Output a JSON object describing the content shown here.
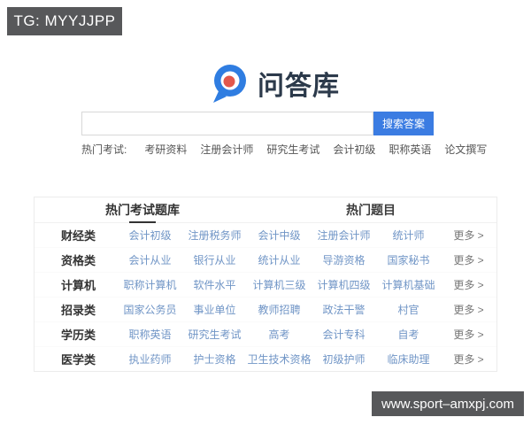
{
  "badges": {
    "top_left": "TG: MYYJJPP",
    "bottom_right": "www.sport–amxpj.com"
  },
  "logo": {
    "text": "问答库"
  },
  "search": {
    "value": "",
    "placeholder": "",
    "button_label": "搜索答案"
  },
  "hot_exams": {
    "label": "热门考试:",
    "links": [
      "考研资料",
      "注册会计师",
      "研究生考试",
      "会计初级",
      "职称英语",
      "论文撰写"
    ]
  },
  "board": {
    "tabs": [
      {
        "label": "热门考试题库",
        "active": true
      },
      {
        "label": "热门题目",
        "active": false
      }
    ],
    "more_label": "更多 >",
    "rows": [
      {
        "category": "财经类",
        "links": [
          "会计初级",
          "注册税务师",
          "会计中级",
          "注册会计师",
          "统计师"
        ]
      },
      {
        "category": "资格类",
        "links": [
          "会计从业",
          "银行从业",
          "统计从业",
          "导游资格",
          "国家秘书"
        ]
      },
      {
        "category": "计算机",
        "links": [
          "职称计算机",
          "软件水平",
          "计算机三级",
          "计算机四级",
          "计算机基础"
        ]
      },
      {
        "category": "招录类",
        "links": [
          "国家公务员",
          "事业单位",
          "教师招聘",
          "政法干警",
          "村官"
        ]
      },
      {
        "category": "学历类",
        "links": [
          "职称英语",
          "研究生考试",
          "高考",
          "会计专科",
          "自考"
        ]
      },
      {
        "category": "医学类",
        "links": [
          "执业药师",
          "护士资格",
          "卫生技术资格",
          "初级护师",
          "临床助理"
        ]
      }
    ]
  },
  "colors": {
    "badge_bg": "#57585a",
    "button_blue": "#3b7ce2",
    "logo_blue": "#2f7de1",
    "logo_dot_red": "#e2574c",
    "link_blue": "#7095c6",
    "text_dark": "#333333",
    "border_light": "#ececec"
  }
}
